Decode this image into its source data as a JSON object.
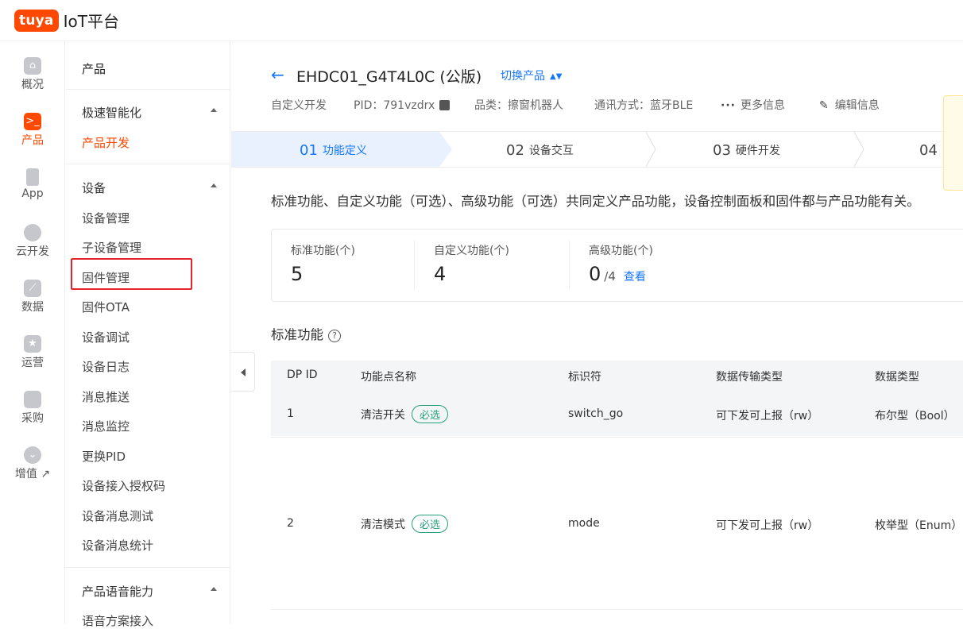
{
  "brand": {
    "logo_text": "tuya",
    "app_title": "IoT平台"
  },
  "iconbar": {
    "items": [
      {
        "label": "概况",
        "icon": "home-icon"
      },
      {
        "label": "产品",
        "icon": "terminal-icon",
        "active": true
      },
      {
        "label": "App",
        "icon": "phone-icon"
      },
      {
        "label": "云开发",
        "icon": "cloud-icon"
      },
      {
        "label": "数据",
        "icon": "chart-icon"
      },
      {
        "label": "运营",
        "icon": "star-bookmark-icon"
      },
      {
        "label": "采购",
        "icon": "box-icon"
      },
      {
        "label": "增值 ↗",
        "icon": "diamond-icon"
      }
    ]
  },
  "submenu": {
    "head": "产品",
    "group1": {
      "label": "极速智能化",
      "items": [
        "产品开发"
      ]
    },
    "group2": {
      "label": "设备",
      "items": [
        "设备管理",
        "子设备管理",
        "固件管理",
        "固件OTA",
        "设备调试",
        "设备日志",
        "消息推送",
        "消息监控",
        "更换PID",
        "设备接入授权码",
        "设备消息测试",
        "设备消息统计"
      ]
    },
    "group3": {
      "label": "产品语音能力",
      "items": [
        "语音方案接入"
      ]
    }
  },
  "product": {
    "title": "EHDC01_G4T4L0C (公版)",
    "switch_label": "切换产品",
    "dev_type": "自定义开发",
    "pid": "PID：791vzdrx",
    "category": "品类：擦窗机器人",
    "protocol": "通讯方式：蓝牙BLE",
    "more": "更多信息",
    "edit": "编辑信息"
  },
  "steps": [
    {
      "num": "01",
      "label": "功能定义",
      "active": true
    },
    {
      "num": "02",
      "label": "设备交互"
    },
    {
      "num": "03",
      "label": "硬件开发"
    },
    {
      "num": "04",
      "label": ""
    }
  ],
  "description": "标准功能、自定义功能（可选）、高级功能（可选）共同定义产品功能，设备控制面板和固件都与产品功能有关。",
  "stats": [
    {
      "label": "标准功能(个)",
      "value": "5"
    },
    {
      "label": "自定义功能(个)",
      "value": "4"
    },
    {
      "label": "高级功能(个)",
      "value": "0",
      "sub": "/4",
      "link": "查看"
    }
  ],
  "section_title": "标准功能",
  "table": {
    "headers": [
      "DP ID",
      "功能点名称",
      "标识符",
      "数据传输类型",
      "数据类型"
    ],
    "rows": [
      {
        "id": "1",
        "name": "清洁开关",
        "tag": "必选",
        "code": "switch_go",
        "transfer": "可下发可上报（rw）",
        "type": "布尔型（Bool）"
      },
      {
        "id": "2",
        "name": "清洁模式",
        "tag": "必选",
        "code": "mode",
        "transfer": "可下发可上报（rw）",
        "type": "枚举型（Enum）"
      }
    ]
  },
  "colors": {
    "brand": "#ff4800",
    "link": "#1677ff",
    "tag_green": "#27a17b",
    "highlight_red": "#e8212b"
  }
}
